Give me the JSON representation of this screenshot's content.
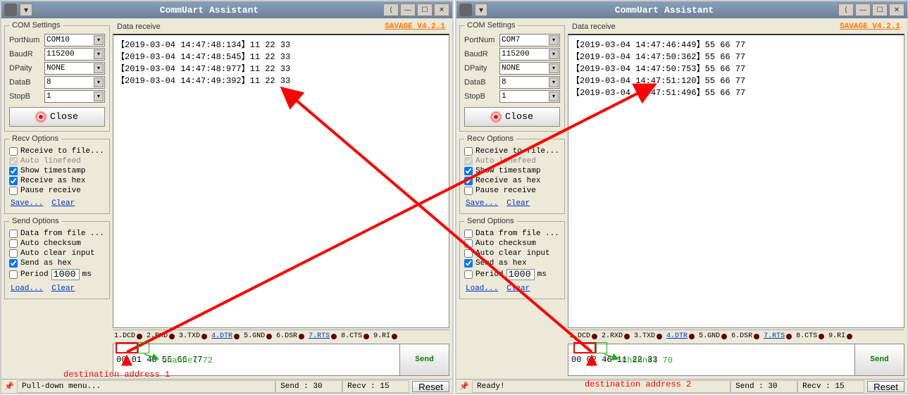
{
  "windows": [
    {
      "title": "CommUart Assistant",
      "com_settings": {
        "legend": "COM Settings",
        "port_label": "PortNum",
        "port_value": "COM10",
        "baud_label": "BaudR",
        "baud_value": "115200",
        "parity_label": "DPaity",
        "parity_value": "NONE",
        "datab_label": "DataB",
        "datab_value": "8",
        "stopb_label": "StopB",
        "stopb_value": "1",
        "close_label": "Close"
      },
      "recv_options": {
        "legend": "Recv Options",
        "to_file": "Receive to file...",
        "auto_linefeed": "Auto linefeed",
        "show_timestamp": "Show timestamp",
        "receive_as_hex": "Receive as hex",
        "pause_receive": "Pause receive",
        "save": "Save...",
        "clear": "Clear"
      },
      "send_options": {
        "legend": "Send Options",
        "data_from_file": "Data from file ...",
        "auto_checksum": "Auto checksum",
        "auto_clear": "Auto clear input",
        "send_as_hex": "Send as hex",
        "period_label": "Period",
        "period_value": "1000",
        "period_unit": "ms",
        "load": "Load...",
        "clear": "Clear"
      },
      "data_receive_label": "Data receive",
      "version": "SAVAGE V4.2.1",
      "receive_lines": [
        "【2019-03-04 14:47:48:134】11 22 33 ",
        "【2019-03-04 14:47:48:545】11 22 33 ",
        "【2019-03-04 14:47:48:977】11 22 33 ",
        "【2019-03-04 14:47:49:392】11 22 33 "
      ],
      "signals": [
        "1.DCD",
        "2.RXD",
        "3.TXD",
        "4.DTR",
        "5.GND",
        "6.DSR",
        "7.RTS",
        "8.CTS",
        "9.RI"
      ],
      "signal_links": [
        3,
        6
      ],
      "send_value": "00 01 48 55 66 77",
      "send_btn": "Send",
      "status_left": "Pull-down menu...",
      "status_send": "Send : 30",
      "status_recv": "Recv : 15",
      "status_reset": "Reset"
    },
    {
      "title": "CommUart Assistant",
      "com_settings": {
        "legend": "COM Settings",
        "port_label": "PortNum",
        "port_value": "COM7",
        "baud_label": "BaudR",
        "baud_value": "115200",
        "parity_label": "DPaity",
        "parity_value": "NONE",
        "datab_label": "DataB",
        "datab_value": "8",
        "stopb_label": "StopB",
        "stopb_value": "1",
        "close_label": "Close"
      },
      "recv_options": {
        "legend": "Recv Options",
        "to_file": "Receive to file...",
        "auto_linefeed": "Auto linefeed",
        "show_timestamp": "Show timestamp",
        "receive_as_hex": "Receive as hex",
        "pause_receive": "Pause receive",
        "save": "Save...",
        "clear": "Clear"
      },
      "send_options": {
        "legend": "Send Options",
        "data_from_file": "Data from file ...",
        "auto_checksum": "Auto checksum",
        "auto_clear": "Auto clear input",
        "send_as_hex": "Send as hex",
        "period_label": "Period",
        "period_value": "1000",
        "period_unit": "ms",
        "load": "Load...",
        "clear": "Clear"
      },
      "data_receive_label": "Data receive",
      "version": "SAVAGE V4.2.1",
      "receive_lines": [
        "【2019-03-04 14:47:46:449】55 66 77 ",
        "【2019-03-04 14:47:50:362】55 66 77 ",
        "【2019-03-04 14:47:50:753】55 66 77 ",
        "【2019-03-04 14:47:51:120】55 66 77 ",
        "【2019-03-04 14:47:51:496】55 66 77 "
      ],
      "signals": [
        "1.DCD",
        "2.RXD",
        "3.TXD",
        "4.DTR",
        "5.GND",
        "6.DSR",
        "7.RTS",
        "8.CTS",
        "9.RI"
      ],
      "signal_links": [
        3,
        6
      ],
      "send_value": "00 02 46 11 22 33",
      "send_btn": "Send",
      "status_left": "Ready!",
      "status_send": "Send : 30",
      "status_recv": "Recv : 15",
      "status_reset": "Reset"
    }
  ],
  "annotations": {
    "ch1": "channel 72",
    "ch2": "channel 70",
    "dest1": "destination address 1",
    "dest2": "destination address 2"
  }
}
